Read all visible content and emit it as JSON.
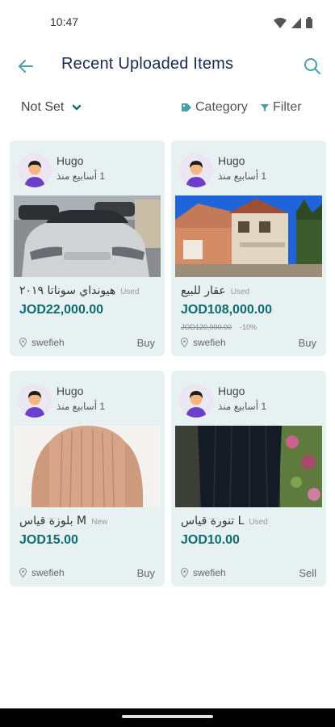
{
  "status_bar": {
    "time": "10:47",
    "icons": [
      "wifi-icon",
      "signal-icon",
      "battery-icon"
    ]
  },
  "header": {
    "title": "Recent Uploaded Items",
    "back_icon": "arrow-left-icon",
    "search_icon": "search-icon"
  },
  "filters": {
    "sort_value": "Not Set",
    "category_label": "Category",
    "filter_label": "Filter"
  },
  "colors": {
    "accent": "#0d6b70",
    "icon_teal": "#4a9fa3",
    "card_bg": "#e8f1f2",
    "title": "#1b2a4a"
  },
  "items": [
    {
      "seller": "Hugo",
      "time_ago": "1 أسابيع منذ",
      "title": "هيونداي سوناتا ٢٠١٩",
      "condition": "Used",
      "price": "JOD22,000.00",
      "old_price": "",
      "discount": "",
      "location": "swefieh",
      "deal_type": "Buy",
      "photo": "car"
    },
    {
      "seller": "Hugo",
      "time_ago": "1 أسابيع منذ",
      "title": "عقار للبيع",
      "condition": "Used",
      "price": "JOD108,000.00",
      "old_price": "JOD120,000.00",
      "discount": "-10%",
      "location": "swefieh",
      "deal_type": "Buy",
      "photo": "house"
    },
    {
      "seller": "Hugo",
      "time_ago": "1 أسابيع منذ",
      "title": "بلوزة قياس M",
      "condition": "New",
      "price": "JOD15.00",
      "old_price": "",
      "discount": "",
      "location": "swefieh",
      "deal_type": "Buy",
      "photo": "sweater"
    },
    {
      "seller": "Hugo",
      "time_ago": "1 أسابيع منذ",
      "title": "تنورة قياس L",
      "condition": "Used",
      "price": "JOD10.00",
      "old_price": "",
      "discount": "",
      "location": "swefieh",
      "deal_type": "Sell",
      "photo": "skirt"
    }
  ]
}
